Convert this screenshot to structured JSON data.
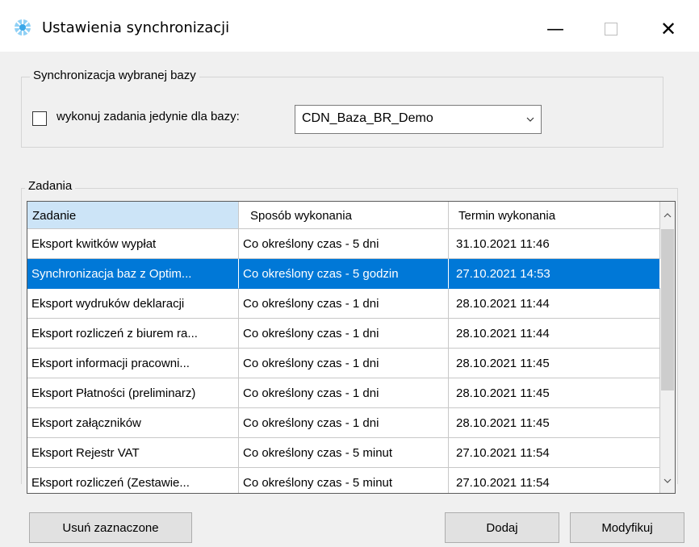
{
  "window": {
    "title": "Ustawienia synchronizacji",
    "minimize": "—",
    "close": "✕"
  },
  "sync_group": {
    "legend": "Synchronizacja wybranej bazy",
    "checkbox_label": "wykonuj zadania jedynie dla bazy:",
    "checkbox_checked": false,
    "database_value": "CDN_Baza_BR_Demo"
  },
  "tasks_group": {
    "legend": "Zadania",
    "columns": [
      "Zadanie",
      "Sposób wykonania",
      "Termin wykonania"
    ],
    "rows": [
      {
        "task": "Eksport kwitków wypłat",
        "mode": "Co określony czas - 5 dni",
        "date": "31.10.2021 11:46"
      },
      {
        "task": "Synchronizacja baz z Optim...",
        "mode": "Co określony czas - 5 godzin",
        "date": "27.10.2021 14:53"
      },
      {
        "task": "Eksport wydruków deklaracji",
        "mode": "Co określony czas - 1 dni",
        "date": "28.10.2021 11:44"
      },
      {
        "task": "Eksport rozliczeń z biurem ra...",
        "mode": "Co określony czas - 1 dni",
        "date": "28.10.2021 11:44"
      },
      {
        "task": "Eksport informacji pracowni...",
        "mode": "Co określony czas - 1 dni",
        "date": "28.10.2021 11:45"
      },
      {
        "task": "Eksport Płatności (preliminarz)",
        "mode": "Co określony czas - 1 dni",
        "date": "28.10.2021 11:45"
      },
      {
        "task": "Eksport załączników",
        "mode": "Co określony czas - 1 dni",
        "date": "28.10.2021 11:45"
      },
      {
        "task": "Eksport Rejestr VAT",
        "mode": "Co określony czas - 5 minut",
        "date": "27.10.2021 11:54"
      },
      {
        "task": "Eksport rozliczeń (Zestawie...",
        "mode": "Co określony czas - 5 minut",
        "date": "27.10.2021 11:54"
      }
    ],
    "selected_row": 1
  },
  "buttons": {
    "delete": "Usuń zaznaczone",
    "add": "Dodaj",
    "modify": "Modyfikuj"
  },
  "colors": {
    "selection": "#0078d7",
    "header_active": "#cce4f7",
    "button_face": "#e1e1e1"
  },
  "icons": {
    "app": "sync-gear-icon",
    "combo": "chevron-down-icon",
    "scroll_up": "chevron-up-icon",
    "scroll_down": "chevron-down-icon"
  }
}
